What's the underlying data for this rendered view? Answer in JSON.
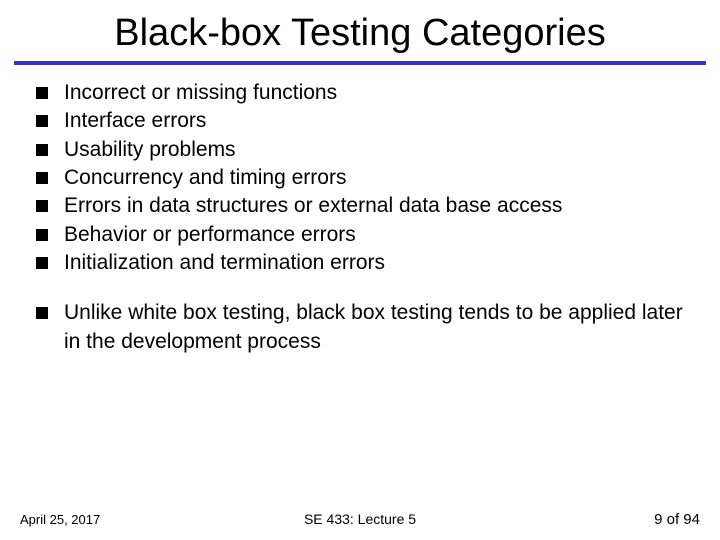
{
  "title": "Black-box Testing Categories",
  "group1": {
    "b0": "Incorrect or missing functions",
    "b1": "Interface errors",
    "b2": "Usability problems",
    "b3": "Concurrency and timing errors",
    "b4": "Errors in data structures or external data base access",
    "b5": "Behavior or performance errors",
    "b6": "Initialization and termination errors"
  },
  "group2": {
    "b0": "Unlike white box testing, black box testing tends to be applied later in the development process"
  },
  "footer": {
    "date": "April 25, 2017",
    "center": "SE 433: Lecture 5",
    "page": "9 of 94"
  }
}
